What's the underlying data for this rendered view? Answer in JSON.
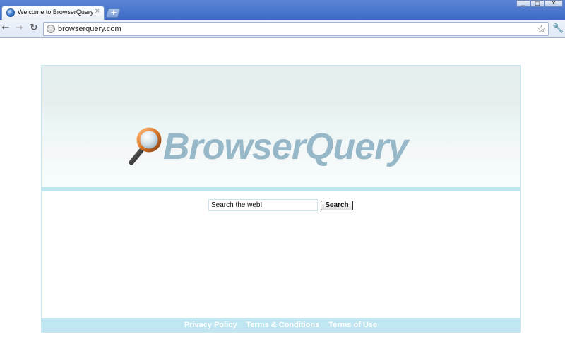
{
  "browser": {
    "tab_title": "Welcome to BrowserQuery",
    "tab_close": "×",
    "new_tab": "+",
    "url": "browserquery.com",
    "window_controls": {
      "minimize": "▁",
      "maximize": "□",
      "close": "✕"
    },
    "nav": {
      "back": "←",
      "forward": "→",
      "reload": "↻"
    },
    "icons": [
      "globe-favicon",
      "page-icon",
      "star-icon",
      "wrench-icon"
    ]
  },
  "page": {
    "logo_text": "BrowserQuery",
    "search": {
      "value": "Search the web!",
      "button_label": "Search"
    },
    "footer_links": [
      "Privacy Policy",
      "Terms & Conditions",
      "Terms of Use"
    ]
  },
  "colors": {
    "titlebar": "#3c69c5",
    "logo": "#97b8c8",
    "footer_bg": "#c0e6f2",
    "stripe": "#bfe6ef"
  }
}
